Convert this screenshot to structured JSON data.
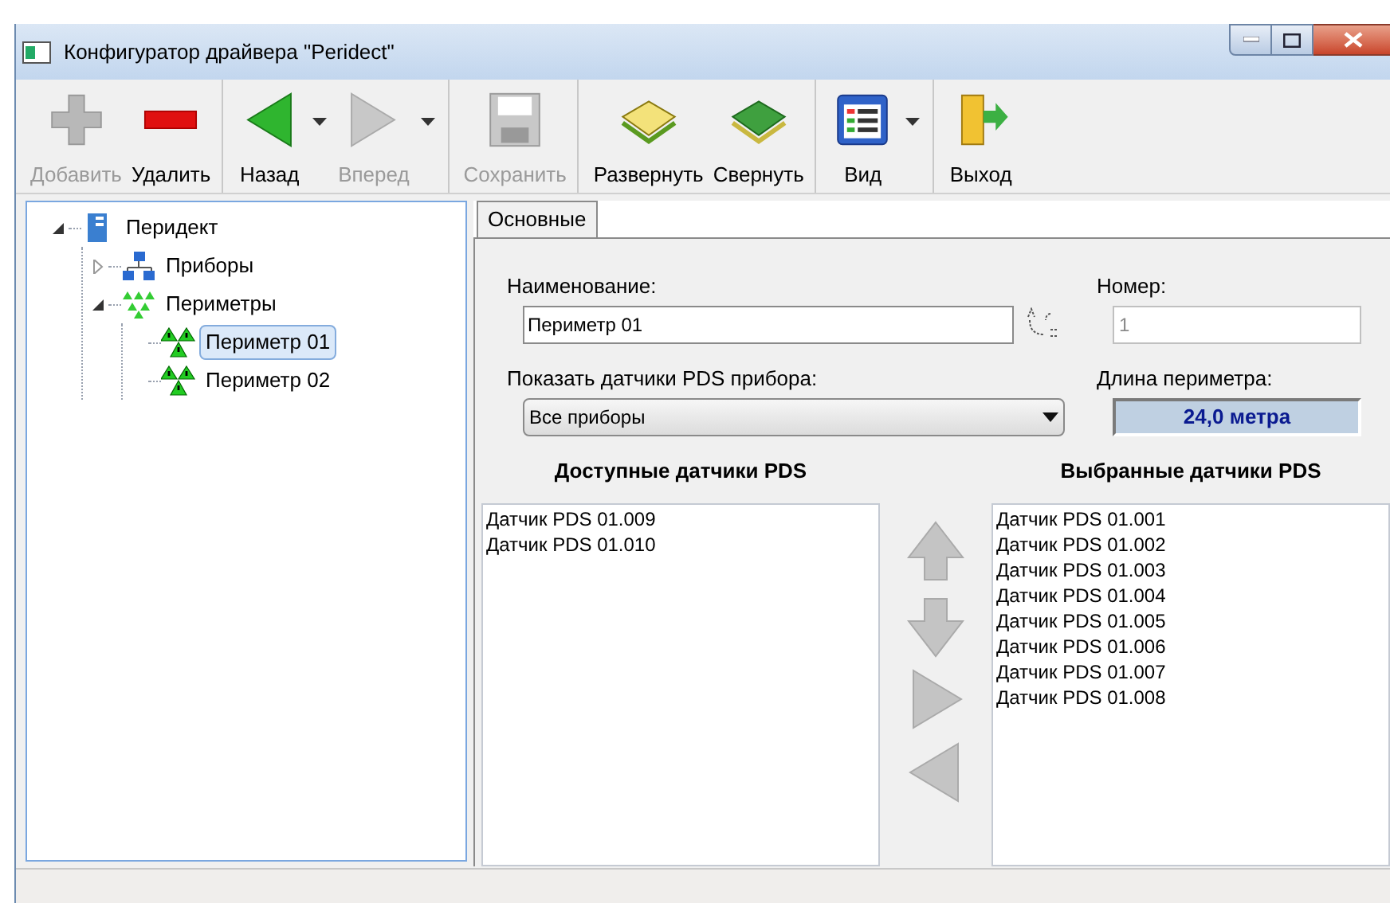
{
  "window": {
    "title": "Конфигуратор драйвера \"Peridect\""
  },
  "toolbar_groups": [
    {
      "buttons": [
        {
          "kind": "add",
          "label": "Добавить",
          "disabled": true,
          "dropdown": false
        },
        {
          "kind": "delete",
          "label": "Удалить",
          "disabled": false,
          "dropdown": false
        }
      ]
    },
    {
      "buttons": [
        {
          "kind": "back",
          "label": "Назад",
          "disabled": false,
          "dropdown": true
        },
        {
          "kind": "forward",
          "label": "Вперед",
          "disabled": true,
          "dropdown": true
        }
      ]
    },
    {
      "buttons": [
        {
          "kind": "save",
          "label": "Сохранить",
          "disabled": true,
          "dropdown": false
        }
      ]
    },
    {
      "buttons": [
        {
          "kind": "expand",
          "label": "Развернуть",
          "disabled": false,
          "dropdown": false
        },
        {
          "kind": "collapse",
          "label": "Свернуть",
          "disabled": false,
          "dropdown": false
        }
      ]
    },
    {
      "buttons": [
        {
          "kind": "view",
          "label": "Вид",
          "disabled": false,
          "dropdown": true
        }
      ]
    },
    {
      "buttons": [
        {
          "kind": "exit",
          "label": "Выход",
          "disabled": false,
          "dropdown": false
        }
      ]
    }
  ],
  "tree": [
    {
      "kind": "root",
      "label": "Перидект",
      "expanded": true,
      "selected": false,
      "children": [
        {
          "kind": "devices",
          "label": "Приборы",
          "expanded": false,
          "selected": false
        },
        {
          "kind": "perimeters",
          "label": "Периметры",
          "expanded": true,
          "selected": false,
          "children": [
            {
              "kind": "perimeter",
              "label": "Периметр 01",
              "selected": true
            },
            {
              "kind": "perimeter",
              "label": "Периметр 02",
              "selected": false
            }
          ]
        }
      ]
    }
  ],
  "tabs": [
    {
      "label": "Основные",
      "selected": true
    }
  ],
  "form": {
    "name_label": "Наименование:",
    "name_value": "Периметр 01",
    "number_label": "Номер:",
    "number_value": "1",
    "filter_label": "Показать датчики PDS прибора:",
    "filter_value": "Все приборы",
    "length_label": "Длина периметра:",
    "length_value": "24,0 метра"
  },
  "available": {
    "title": "Доступные датчики PDS",
    "items": [
      "Датчик PDS 01.009",
      "Датчик PDS 01.010"
    ]
  },
  "selected_list": {
    "title": "Выбранные датчики PDS",
    "items": [
      "Датчик PDS 01.001",
      "Датчик PDS 01.002",
      "Датчик PDS 01.003",
      "Датчик PDS 01.004",
      "Датчик PDS 01.005",
      "Датчик PDS 01.006",
      "Датчик PDS 01.007",
      "Датчик PDS 01.008"
    ]
  },
  "move_buttons": [
    {
      "kind": "up"
    },
    {
      "kind": "down"
    },
    {
      "kind": "right"
    },
    {
      "kind": "left"
    }
  ]
}
